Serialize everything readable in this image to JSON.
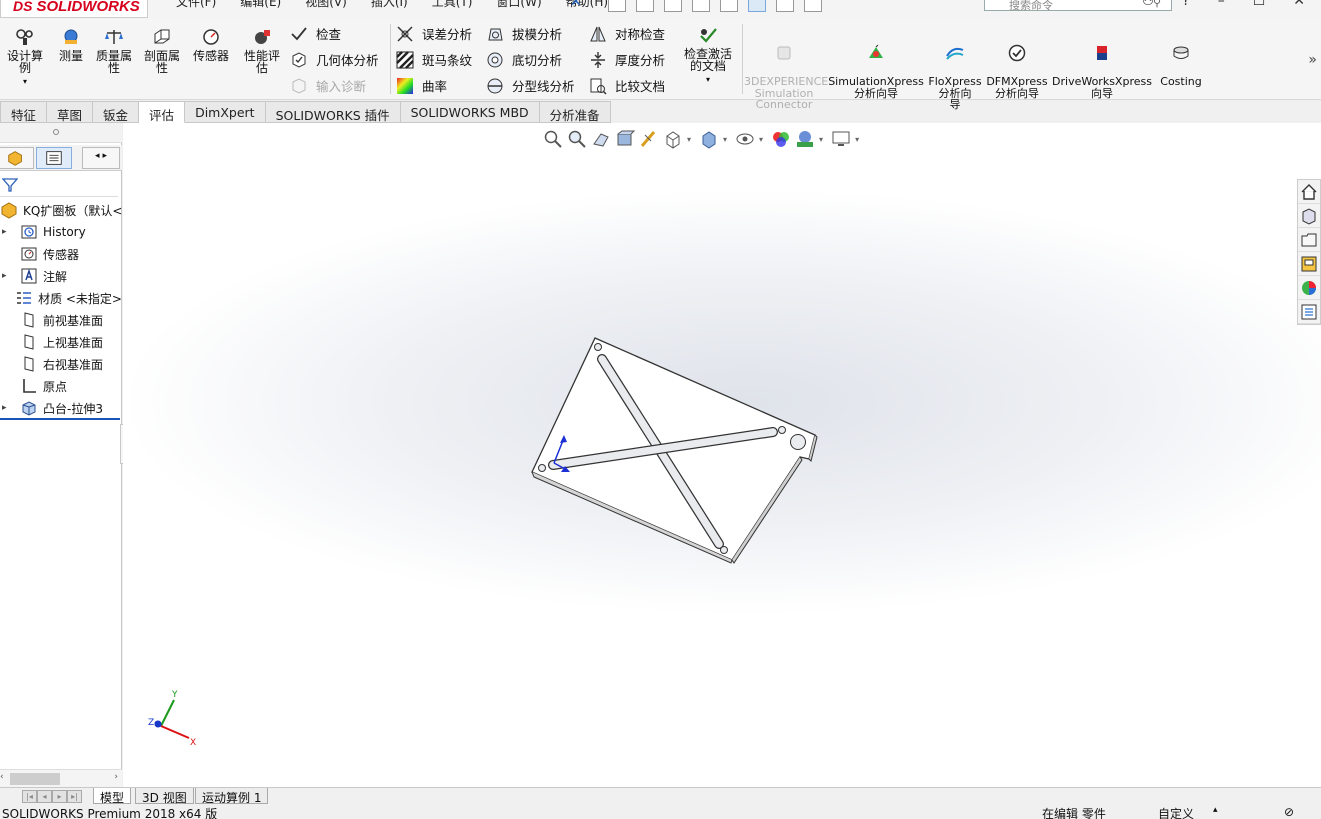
{
  "app": {
    "logo": "SOLIDWORKS",
    "logo_mark": "DS"
  },
  "menu": [
    "文件(F)",
    "编辑(E)",
    "视图(V)",
    "插入(I)",
    "工具(T)",
    "窗口(W)",
    "帮助(H)"
  ],
  "search": {
    "placeholder": "搜索命令"
  },
  "ribbon": {
    "design_study": "设计算\n例",
    "measure": "测量",
    "mass_props": "质量属\n性",
    "section_props": "剖面属\n性",
    "sensor": "传感器",
    "perf_eval": "性能评\n估",
    "check": "检查",
    "geometry_analysis": "几何体分析",
    "import_diagnostics": "输入诊断",
    "deviation_analysis": "误差分析",
    "zebra_stripes": "斑马条纹",
    "curvature": "曲率",
    "draft_analysis": "拔模分析",
    "undercut_analysis": "底切分析",
    "parting_line_analysis": "分型线分析",
    "symmetry_check": "对称检查",
    "thickness_analysis": "厚度分析",
    "compare_documents": "比较文档",
    "check_active_doc": "检查激活\n的文档",
    "addins": [
      {
        "label": "3DEXPERIENCE\nSimulation\nConnector",
        "disabled": true
      },
      {
        "label": "SimulationXpress\n分析向导",
        "disabled": false
      },
      {
        "label": "FloXpress\n分析向\n导",
        "disabled": false
      },
      {
        "label": "DFMXpress\n分析向导",
        "disabled": false
      },
      {
        "label": "DriveWorksXpress\n向导",
        "disabled": false
      },
      {
        "label": "Costing",
        "disabled": false
      }
    ]
  },
  "tabs": [
    "特征",
    "草图",
    "钣金",
    "评估",
    "DimXpert",
    "SOLIDWORKS 插件",
    "SOLIDWORKS MBD",
    "分析准备"
  ],
  "active_tab": "评估",
  "feature_tree": {
    "root": "KQ扩圈板（默认<",
    "items": [
      {
        "label": "History",
        "expandable": true,
        "icon": "history-icon"
      },
      {
        "label": "传感器",
        "expandable": false,
        "icon": "sensor-icon"
      },
      {
        "label": "注解",
        "expandable": true,
        "icon": "annotation-icon"
      },
      {
        "label": "材质 <未指定>",
        "expandable": false,
        "icon": "material-icon"
      },
      {
        "label": "前视基准面",
        "expandable": false,
        "icon": "plane-icon"
      },
      {
        "label": "上视基准面",
        "expandable": false,
        "icon": "plane-icon"
      },
      {
        "label": "右视基准面",
        "expandable": false,
        "icon": "plane-icon"
      },
      {
        "label": "原点",
        "expandable": false,
        "icon": "origin-icon"
      },
      {
        "label": "凸台-拉伸3",
        "expandable": true,
        "icon": "extrude-icon"
      }
    ]
  },
  "triad": {
    "x": "X",
    "y": "Y",
    "z": "Z"
  },
  "bottom_tabs": [
    "模型",
    "3D 视图",
    "运动算例 1"
  ],
  "status": {
    "product": "SOLIDWORKS Premium 2018 x64 版",
    "mode": "在编辑 零件",
    "units": "自定义"
  },
  "colors": {
    "accent": "#1a53b6",
    "brand": "#d6001c"
  }
}
